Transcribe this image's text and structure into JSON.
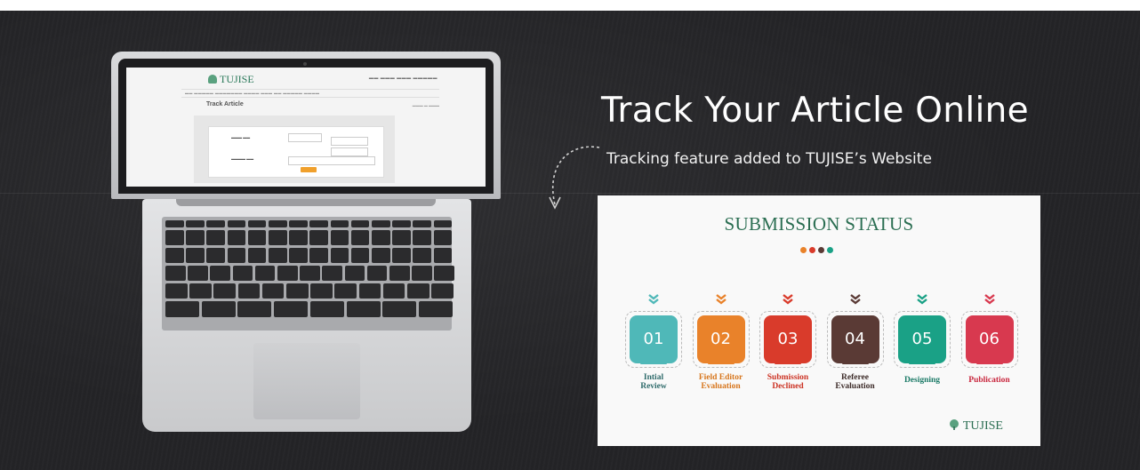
{
  "headline": "Track Your Article Online",
  "subheadline": "Tracking feature added to TUJISE’s Website",
  "laptop_site": {
    "logo": "TUJISE",
    "page_title": "Track Article"
  },
  "status_card": {
    "title": "SUBMISSION STATUS",
    "dot_colors": [
      "#e9822a",
      "#d93b2b",
      "#5a3a35",
      "#1aa186"
    ],
    "logo_text": "TUJISE",
    "steps": [
      {
        "number": "01",
        "label_line1": "Intial",
        "label_line2": "Review",
        "color": "#4fb8b8",
        "label_color": "#2f6b6b"
      },
      {
        "number": "02",
        "label_line1": "Field Editor",
        "label_line2": "Evaluation",
        "color": "#e9822a",
        "label_color": "#d7761d"
      },
      {
        "number": "03",
        "label_line1": "Submission",
        "label_line2": "Declined",
        "color": "#d93b2b",
        "label_color": "#cc3324"
      },
      {
        "number": "04",
        "label_line1": "Referee",
        "label_line2": "Evaluation",
        "color": "#5a3a35",
        "label_color": "#3d2c29"
      },
      {
        "number": "05",
        "label_line1": "Designing",
        "label_line2": "",
        "color": "#1aa186",
        "label_color": "#1b7a67"
      },
      {
        "number": "06",
        "label_line1": "Publication",
        "label_line2": "",
        "color": "#d8394f",
        "label_color": "#c9283f"
      }
    ]
  }
}
